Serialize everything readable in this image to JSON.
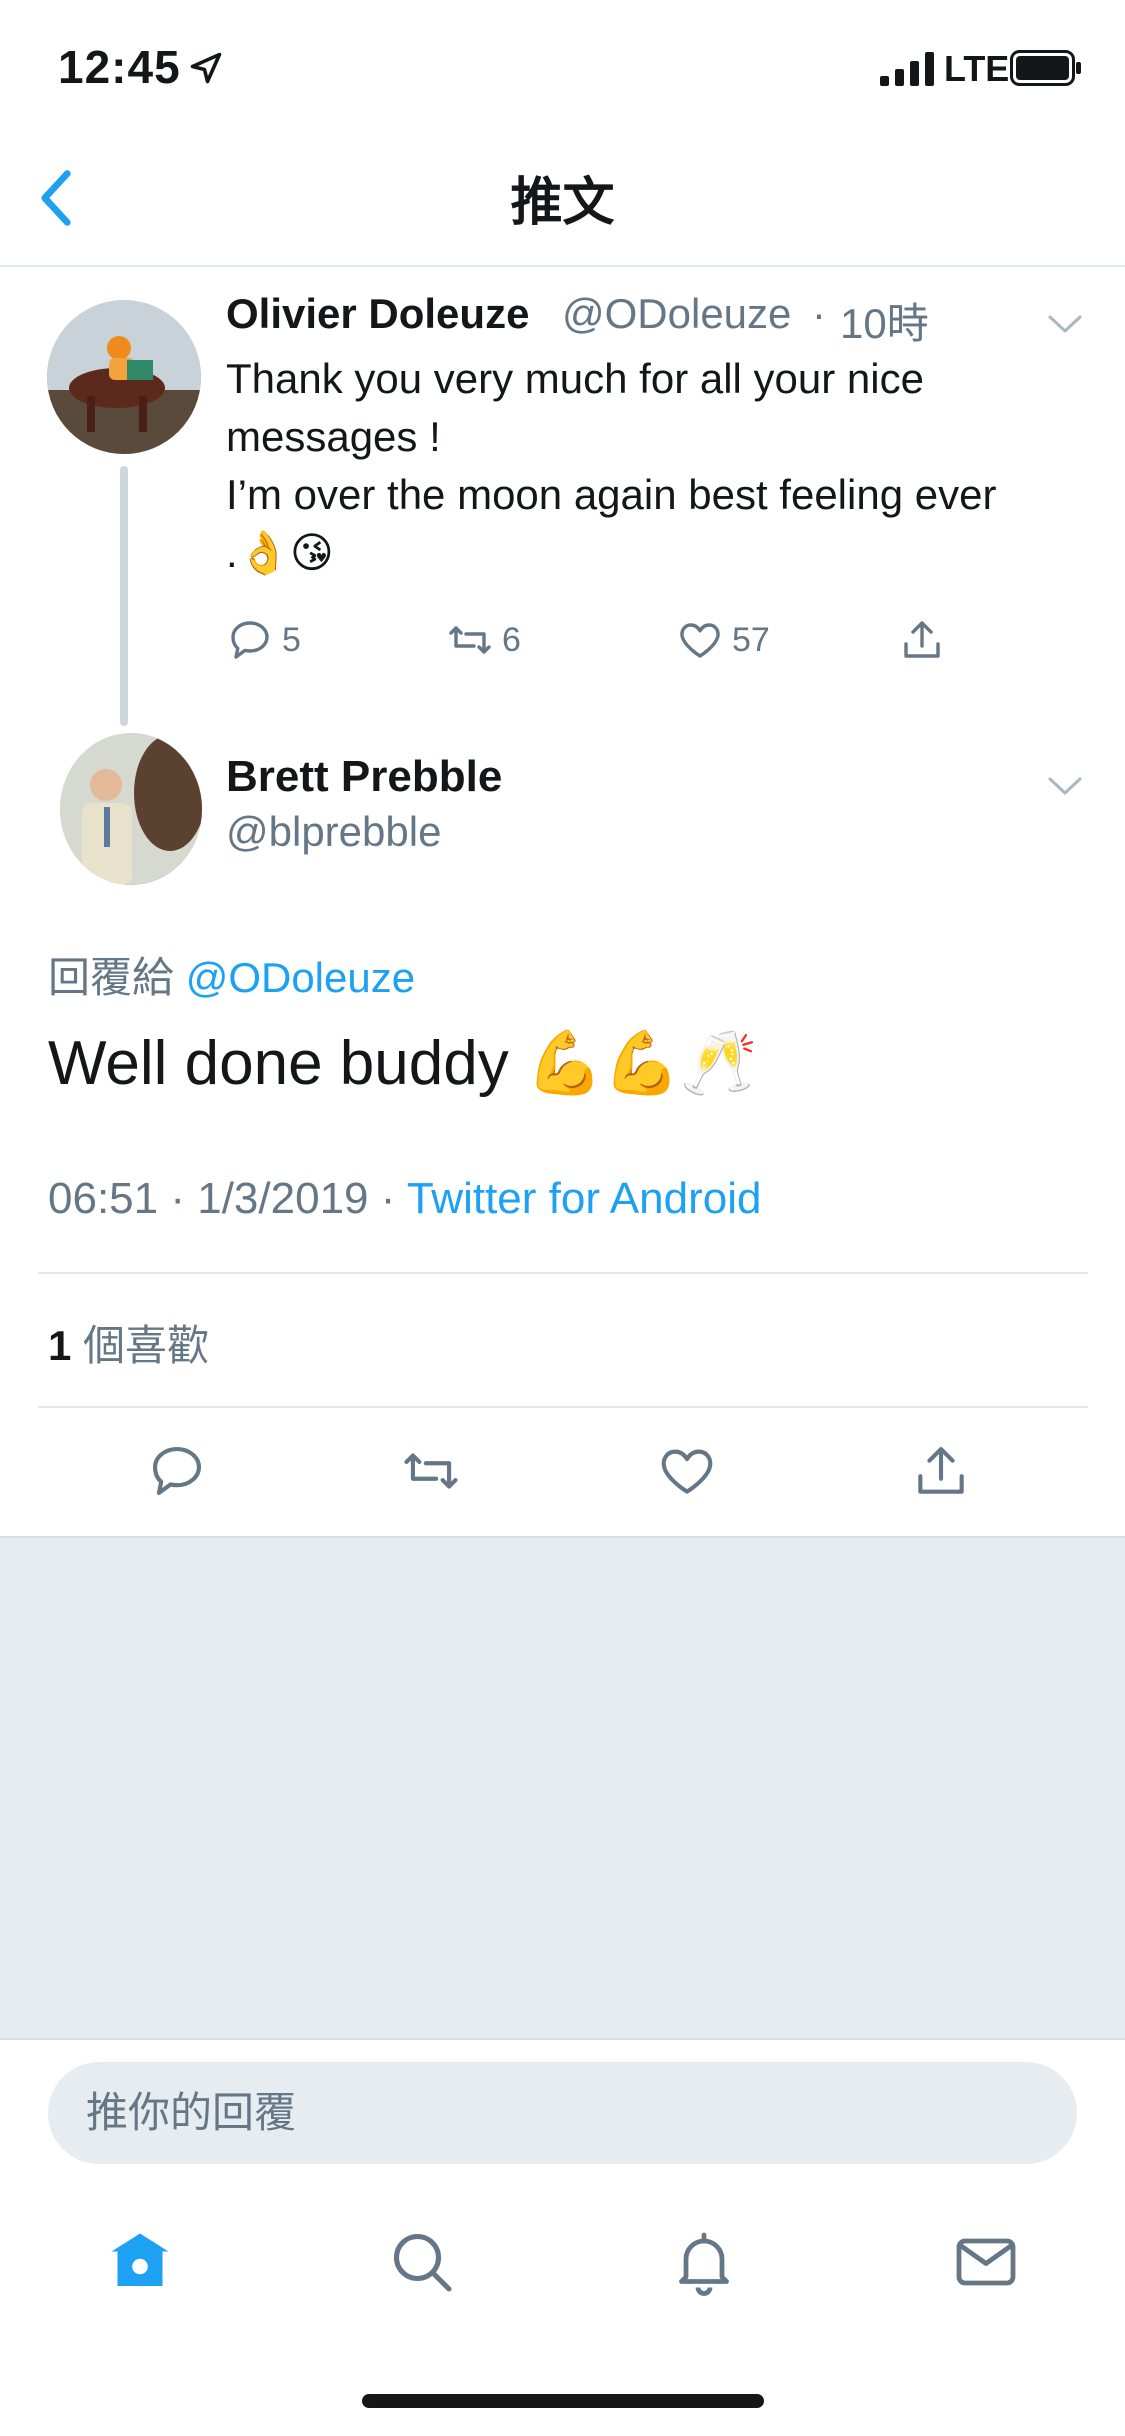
{
  "status_bar": {
    "time": "12:45",
    "network": "LTE"
  },
  "nav": {
    "title": "推文"
  },
  "parent_tweet": {
    "name": "Olivier Doleuze",
    "handle": "@ODoleuze",
    "separator": "·",
    "time": "10時",
    "lines": [
      "Thank you very much for all your nice",
      "messages !",
      "I’m over the moon again best feeling ever",
      ".👌😘"
    ],
    "replies": "5",
    "retweets": "6",
    "likes": "57"
  },
  "focused_tweet": {
    "name": "Brett Prebble",
    "handle": "@blprebble",
    "reply_prefix": "回覆給",
    "reply_to": "@ODoleuze",
    "text": "Well done buddy 💪💪🥂",
    "time": "06:51",
    "date": "1/3/2019",
    "separator": "·",
    "source": "Twitter for Android",
    "likes_count": "1",
    "likes_label": "個喜歡"
  },
  "reply_bar": {
    "placeholder": "推你的回覆"
  },
  "tab_bar": {
    "active": "home",
    "accent_color": "#1da1f2",
    "icons": [
      "home-icon",
      "search-icon",
      "bell-icon",
      "mail-icon"
    ]
  }
}
